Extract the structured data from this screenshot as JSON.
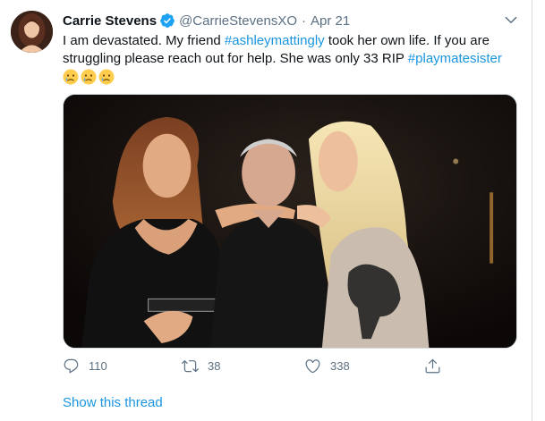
{
  "tweet": {
    "author_name": "Carrie Stevens",
    "author_handle": "@CarrieStevensXO",
    "separator": "·",
    "date": "Apr 21",
    "text_parts": {
      "p1": "I am devastated.  My friend ",
      "hashtag1": "#ashleymattingly",
      "p2": " took her own life. If you are struggling please reach out for help.  She was only 33 RIP ",
      "hashtag2": "#playmatesister"
    },
    "emojis": [
      "crying-face-emoji",
      "crying-face-emoji",
      "crying-face-emoji"
    ]
  },
  "actions": {
    "reply_count": "110",
    "retweet_count": "38",
    "like_count": "338"
  },
  "thread_link": "Show this thread",
  "colors": {
    "link": "#1b95e0",
    "muted": "#5b7083",
    "verified": "#1da1f2"
  }
}
